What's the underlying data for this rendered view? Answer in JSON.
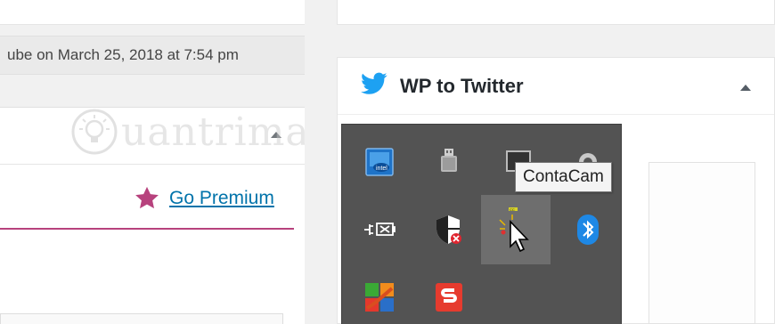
{
  "left": {
    "meta_text": "ube on March 25, 2018 at 7:54 pm",
    "go_premium_label": "Go Premium"
  },
  "watermark": {
    "text": "uantrimang"
  },
  "sidebar": {
    "wp_to_twitter_title": "WP to Twitter"
  },
  "tray": {
    "tooltip": "ContaCam",
    "icons": [
      "intel-graphics-icon",
      "usb-safely-remove-icon",
      "contacam-monitor-icon",
      "webcam-icon",
      "power-plug-icon",
      "windows-security-alert-icon",
      "contacam-cursor-icon",
      "bluetooth-icon",
      "avg-antivirus-icon",
      "sublime-s-icon"
    ]
  },
  "colors": {
    "accent_link": "#0073aa",
    "premium_star": "#b7427d",
    "twitter_blue": "#1da1f2",
    "tray_bg": "#535353"
  }
}
